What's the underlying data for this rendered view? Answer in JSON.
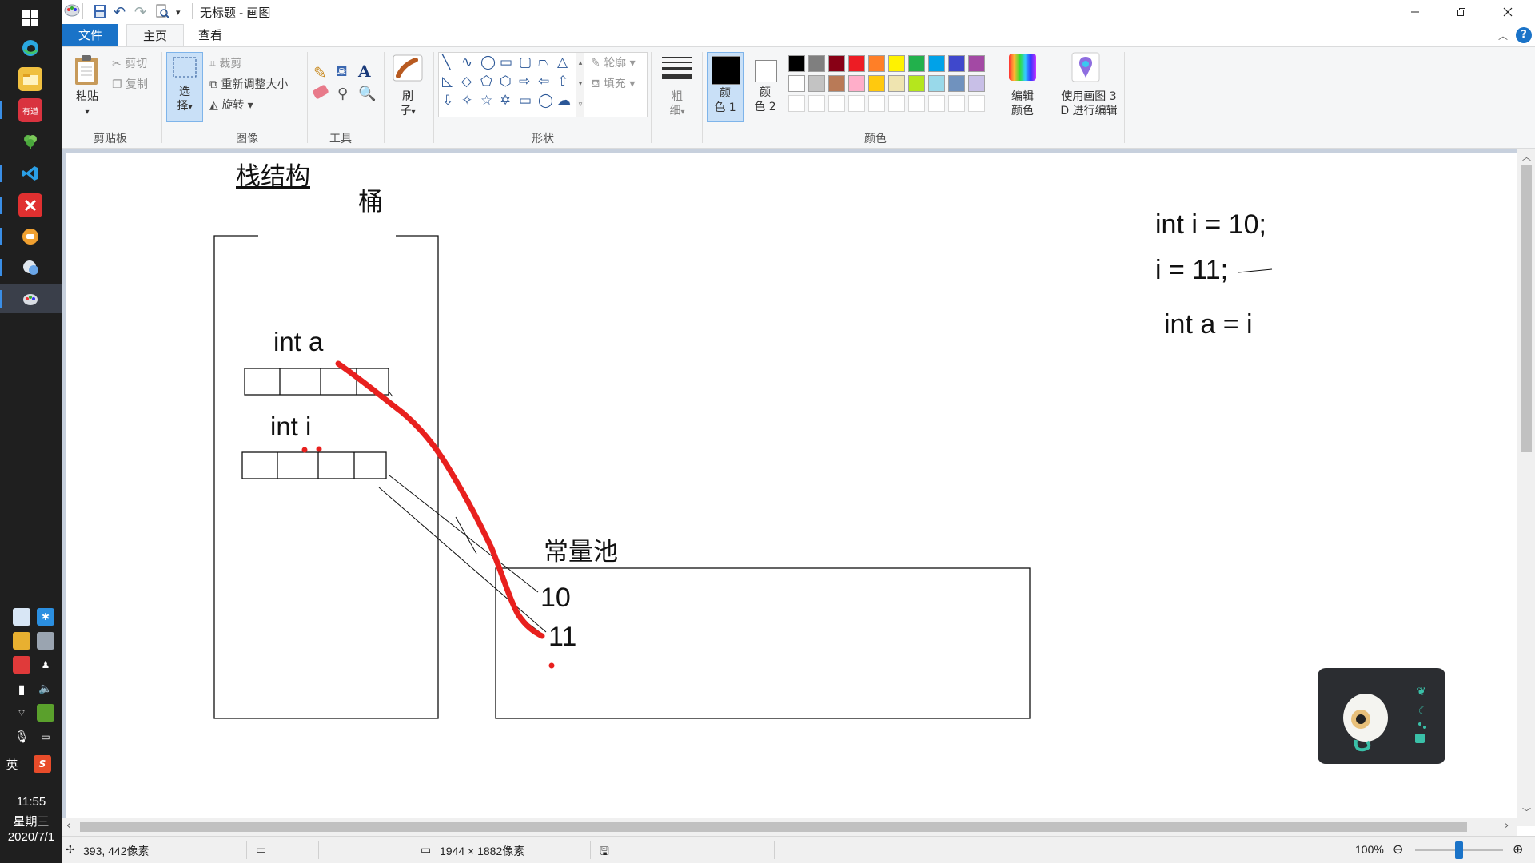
{
  "taskbar": {
    "apps": [
      {
        "icon": "windows-start-icon",
        "color": "#1f1f1f"
      },
      {
        "icon": "edge-icon",
        "color": "#1f1f1f"
      },
      {
        "icon": "file-explorer-icon",
        "color": "#f0c040"
      },
      {
        "icon": "youdao-icon",
        "color": "#d9333f"
      },
      {
        "icon": "clover-icon",
        "color": "#1f1f1f"
      },
      {
        "icon": "vscode-icon",
        "color": "#1f1f1f"
      },
      {
        "icon": "xmind-icon",
        "color": "#e03030"
      },
      {
        "icon": "orange-app-icon",
        "color": "#f0a030"
      },
      {
        "icon": "chat-app-icon",
        "color": "#1f1f1f"
      },
      {
        "icon": "paint-icon",
        "color": "#3a3f4a"
      }
    ],
    "youdao_label": "有道",
    "lang": "英",
    "sogou": "S",
    "time": "11:55",
    "weekday": "星期三",
    "date": "2020/7/1"
  },
  "titlebar": {
    "title": "无标题 - 画图"
  },
  "tabs": {
    "file": "文件",
    "home": "主页",
    "view": "查看"
  },
  "ribbon": {
    "clipboard": {
      "paste": "粘贴",
      "cut": "剪切",
      "copy": "复制",
      "group": "剪贴板"
    },
    "image": {
      "select_line1": "选",
      "select_line2": "择",
      "crop": "裁剪",
      "resize": "重新调整大小",
      "rotate": "旋转",
      "group": "图像"
    },
    "tools": {
      "text_tool": "A",
      "group": "工具"
    },
    "brushes": {
      "line1": "刷",
      "line2": "子"
    },
    "shapes": {
      "outline": "轮廓",
      "fill": "填充",
      "group": "形状"
    },
    "size": {
      "line1": "粗",
      "line2": "细"
    },
    "colors": {
      "color1_line1": "颜",
      "color1_line2": "色 1",
      "color2_line1": "颜",
      "color2_line2": "色 2",
      "edit_line1": "编辑",
      "edit_line2": "颜色",
      "group": "颜色",
      "palette_row1": [
        "#000000",
        "#7f7f7f",
        "#880015",
        "#ed1c24",
        "#ff7f27",
        "#fff200",
        "#22b14c",
        "#00a2e8",
        "#3f48cc",
        "#a349a4"
      ],
      "palette_row2": [
        "#ffffff",
        "#c3c3c3",
        "#b97a57",
        "#ffaec9",
        "#ffc90e",
        "#efe4b0",
        "#b5e61d",
        "#99d9ea",
        "#7092be",
        "#c8bfe7"
      ],
      "primary": "#000000",
      "secondary": "#ffffff"
    },
    "paint3d": {
      "line1": "使用画图 3",
      "line2": "D 进行编辑"
    }
  },
  "canvas": {
    "stack_title": "栈结构",
    "bucket": "桶",
    "var_a": "int  a",
    "var_i": "int i",
    "pool_title": "常量池",
    "val_10": "10",
    "val_11": "11",
    "code_line1": "int i  = 10;",
    "code_line2": "i = 11;",
    "code_line3": "int a = i"
  },
  "statusbar": {
    "cursor": "393, 442像素",
    "size": "1944 × 1882像素",
    "zoom": "100%"
  }
}
